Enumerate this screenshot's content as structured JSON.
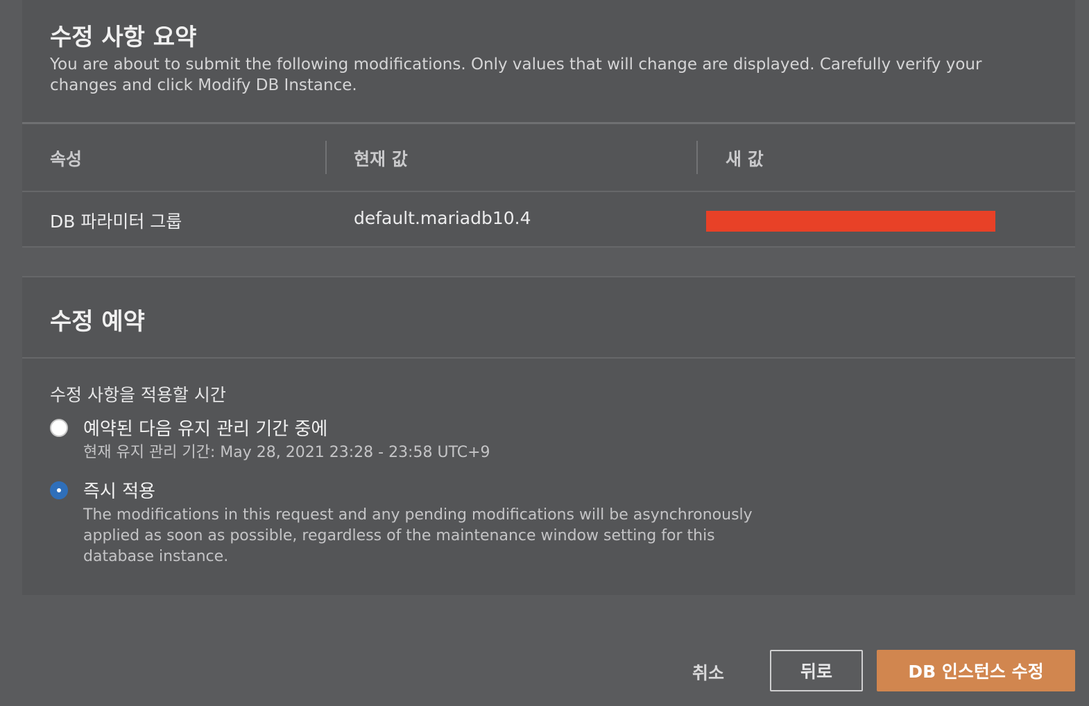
{
  "summary": {
    "title": "수정 사항 요약",
    "description": "You are about to submit the following modifications. Only values that will change are displayed. Carefully verify your changes and click Modify DB Instance."
  },
  "table": {
    "headers": [
      "속성",
      "현재 값",
      "새 값"
    ],
    "rows": [
      {
        "attribute": "DB 파라미터 그룹",
        "current": "default.mariadb10.4",
        "new": ""
      }
    ],
    "redaction_color": "#e84127"
  },
  "schedule": {
    "title": "수정 예약",
    "field_label": "수정 사항을 적용할 시간",
    "options": [
      {
        "label": "예약된 다음 유지 관리 기간 중에",
        "description": "현재 유지 관리 기간: May 28, 2021 23:28 - 23:58 UTC+9",
        "selected": false
      },
      {
        "label": "즉시 적용",
        "description": "The modifications in this request and any pending modifications will be asynchronously applied as soon as possible, regardless of the maintenance window setting for this database instance.",
        "selected": true
      }
    ]
  },
  "actions": {
    "cancel": "취소",
    "back": "뒤로",
    "modify": "DB 인스턴스 수정"
  },
  "colors": {
    "primary_button": "#d1864f",
    "radio_selected": "#2f6fba"
  }
}
